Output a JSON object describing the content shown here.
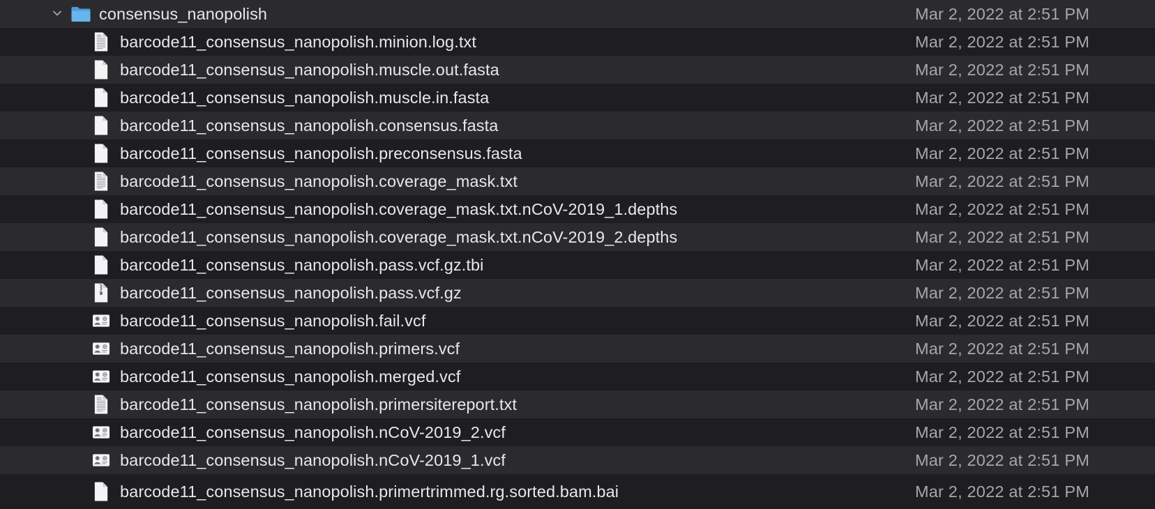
{
  "folder": {
    "name": "consensus_nanopolish",
    "date": "Mar 2, 2022 at 2:51 PM",
    "icon": "folder-icon",
    "expanded": true,
    "color": "#5aa9e6"
  },
  "files": [
    {
      "name": "barcode11_consensus_nanopolish.minion.log.txt",
      "date": "Mar 2, 2022 at 2:51 PM",
      "icon": "text-document-icon"
    },
    {
      "name": "barcode11_consensus_nanopolish.muscle.out.fasta",
      "date": "Mar 2, 2022 at 2:51 PM",
      "icon": "blank-document-icon"
    },
    {
      "name": "barcode11_consensus_nanopolish.muscle.in.fasta",
      "date": "Mar 2, 2022 at 2:51 PM",
      "icon": "blank-document-icon"
    },
    {
      "name": "barcode11_consensus_nanopolish.consensus.fasta",
      "date": "Mar 2, 2022 at 2:51 PM",
      "icon": "blank-document-icon"
    },
    {
      "name": "barcode11_consensus_nanopolish.preconsensus.fasta",
      "date": "Mar 2, 2022 at 2:51 PM",
      "icon": "blank-document-icon"
    },
    {
      "name": "barcode11_consensus_nanopolish.coverage_mask.txt",
      "date": "Mar 2, 2022 at 2:51 PM",
      "icon": "text-document-icon"
    },
    {
      "name": "barcode11_consensus_nanopolish.coverage_mask.txt.nCoV-2019_1.depths",
      "date": "Mar 2, 2022 at 2:51 PM",
      "icon": "blank-document-icon"
    },
    {
      "name": "barcode11_consensus_nanopolish.coverage_mask.txt.nCoV-2019_2.depths",
      "date": "Mar 2, 2022 at 2:51 PM",
      "icon": "blank-document-icon"
    },
    {
      "name": "barcode11_consensus_nanopolish.pass.vcf.gz.tbi",
      "date": "Mar 2, 2022 at 2:51 PM",
      "icon": "blank-document-icon"
    },
    {
      "name": "barcode11_consensus_nanopolish.pass.vcf.gz",
      "date": "Mar 2, 2022 at 2:51 PM",
      "icon": "archive-document-icon"
    },
    {
      "name": "barcode11_consensus_nanopolish.fail.vcf",
      "date": "Mar 2, 2022 at 2:51 PM",
      "icon": "vcard-icon"
    },
    {
      "name": "barcode11_consensus_nanopolish.primers.vcf",
      "date": "Mar 2, 2022 at 2:51 PM",
      "icon": "vcard-icon"
    },
    {
      "name": "barcode11_consensus_nanopolish.merged.vcf",
      "date": "Mar 2, 2022 at 2:51 PM",
      "icon": "vcard-icon"
    },
    {
      "name": "barcode11_consensus_nanopolish.primersitereport.txt",
      "date": "Mar 2, 2022 at 2:51 PM",
      "icon": "text-document-icon"
    },
    {
      "name": "barcode11_consensus_nanopolish.nCoV-2019_2.vcf",
      "date": "Mar 2, 2022 at 2:51 PM",
      "icon": "vcard-icon"
    },
    {
      "name": "barcode11_consensus_nanopolish.nCoV-2019_1.vcf",
      "date": "Mar 2, 2022 at 2:51 PM",
      "icon": "vcard-icon"
    },
    {
      "name": "barcode11_consensus_nanopolish.primertrimmed.rg.sorted.bam.bai",
      "date": "Mar 2, 2022 at 2:51 PM",
      "icon": "blank-document-icon"
    }
  ]
}
